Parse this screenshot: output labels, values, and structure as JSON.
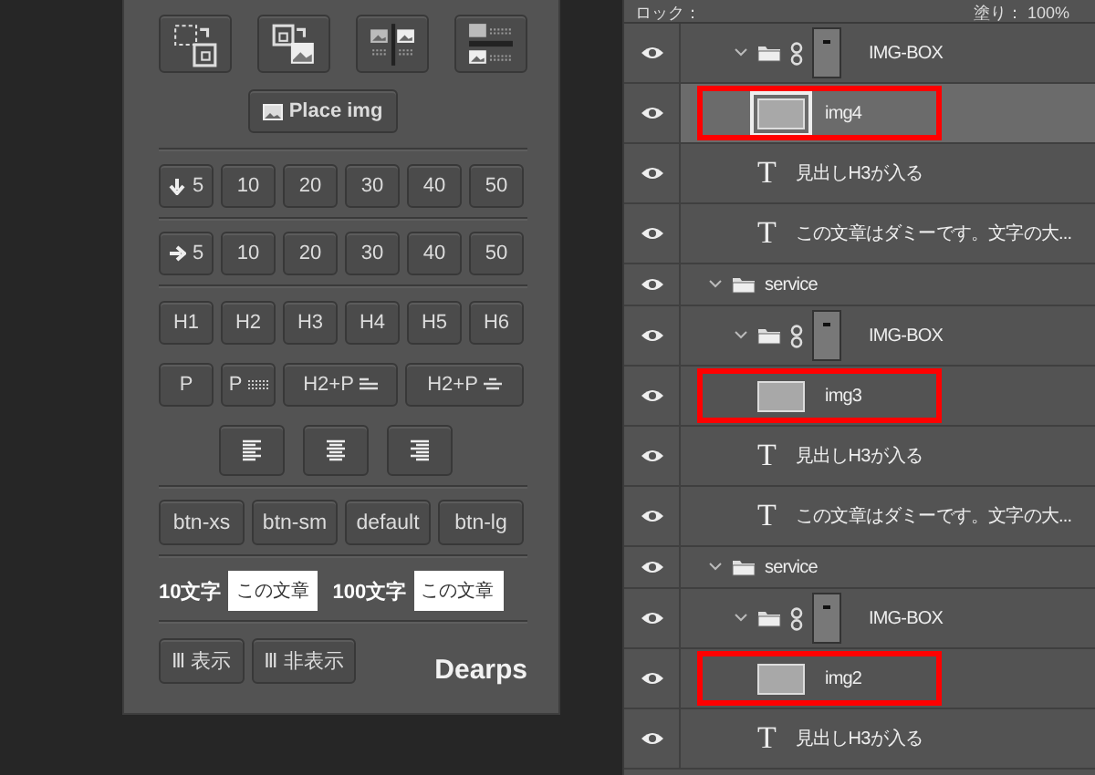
{
  "tool_panel": {
    "icon_buttons": [
      {
        "kind": "swap-box"
      },
      {
        "kind": "swap-image"
      },
      {
        "kind": "two-column"
      },
      {
        "kind": "two-row"
      }
    ],
    "place_button": {
      "label": "Place img"
    },
    "spacing_rows": [
      {
        "kind": "down",
        "buttons": [
          "5",
          "10",
          "20",
          "30",
          "40",
          "50"
        ]
      },
      {
        "kind": "right",
        "buttons": [
          "5",
          "10",
          "20",
          "30",
          "40",
          "50"
        ]
      }
    ],
    "heading_buttons": [
      "H1",
      "H2",
      "H3",
      "H4",
      "H5",
      "H6"
    ],
    "paragraph_buttons": [
      {
        "label": "P",
        "kind": "plain"
      },
      {
        "label": "P",
        "kind": "dotted"
      },
      {
        "label": "H2+P",
        "kind": "left-lines"
      },
      {
        "label": "H2+P",
        "kind": "center-lines"
      }
    ],
    "align_buttons": [
      {
        "kind": "left"
      },
      {
        "kind": "center"
      },
      {
        "kind": "right"
      }
    ],
    "size_buttons": [
      "btn-xs",
      "btn-sm",
      "default",
      "btn-lg"
    ],
    "text_fields": [
      {
        "label": "10文字",
        "value": "この文章"
      },
      {
        "label": "100文字",
        "value": "この文章"
      }
    ],
    "toggle_buttons": [
      {
        "label": "Ⅲ 表示"
      },
      {
        "label": "Ⅲ 非表示"
      }
    ],
    "brand": "Dearps"
  },
  "layers_panel": {
    "toolbar": {
      "lock_label": "ロック：",
      "fill_label": "塗り：",
      "fill_value": "100%"
    },
    "layers": [
      {
        "kind": "masked-group",
        "name": "IMG-BOX",
        "visible": true,
        "expanded": true,
        "children": [
          {
            "kind": "image",
            "name": "img4",
            "visible": true,
            "selected": true,
            "highlighted": true
          },
          {
            "kind": "text",
            "glyph": "T",
            "name": "見出しH3が入る",
            "visible": true
          },
          {
            "kind": "text",
            "glyph": "T",
            "name": "この文章はダミーです。文字の大...",
            "visible": true
          }
        ]
      },
      {
        "kind": "group",
        "name": "service",
        "visible": true,
        "expanded": true,
        "children": [
          {
            "kind": "masked-group",
            "name": "IMG-BOX",
            "visible": true,
            "expanded": true,
            "children": [
              {
                "kind": "image",
                "name": "img3",
                "visible": true,
                "selected": false,
                "highlighted": true
              },
              {
                "kind": "text",
                "glyph": "T",
                "name": "見出しH3が入る",
                "visible": true
              },
              {
                "kind": "text",
                "glyph": "T",
                "name": "この文章はダミーです。文字の大...",
                "visible": true
              }
            ]
          }
        ]
      },
      {
        "kind": "group",
        "name": "service",
        "visible": true,
        "expanded": true,
        "children": [
          {
            "kind": "masked-group",
            "name": "IMG-BOX",
            "visible": true,
            "expanded": true,
            "children": [
              {
                "kind": "image",
                "name": "img2",
                "visible": true,
                "selected": false,
                "highlighted": true
              },
              {
                "kind": "text",
                "glyph": "T",
                "name": "見出しH3が入る",
                "visible": true
              }
            ]
          }
        ]
      }
    ]
  }
}
